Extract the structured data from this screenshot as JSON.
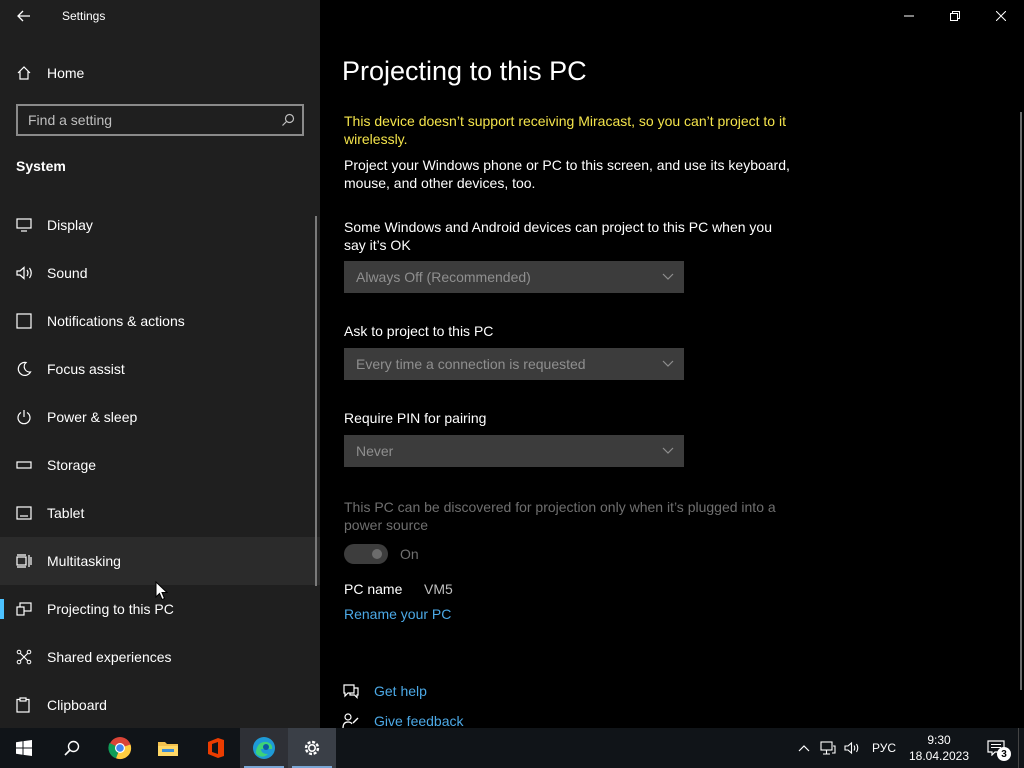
{
  "window": {
    "title": "Settings"
  },
  "sidebar": {
    "home_label": "Home",
    "search_placeholder": "Find a setting",
    "section_title": "System",
    "items": [
      {
        "label": "Display",
        "icon": "display-icon"
      },
      {
        "label": "Sound",
        "icon": "speaker-icon"
      },
      {
        "label": "Notifications & actions",
        "icon": "notifications-icon"
      },
      {
        "label": "Focus assist",
        "icon": "moon-icon"
      },
      {
        "label": "Power & sleep",
        "icon": "power-icon"
      },
      {
        "label": "Storage",
        "icon": "storage-icon"
      },
      {
        "label": "Tablet",
        "icon": "tablet-icon"
      },
      {
        "label": "Multitasking",
        "icon": "multitasking-icon"
      },
      {
        "label": "Projecting to this PC",
        "icon": "projecting-icon"
      },
      {
        "label": "Shared experiences",
        "icon": "shared-experiences-icon"
      },
      {
        "label": "Clipboard",
        "icon": "clipboard-icon"
      }
    ],
    "selected_index": 8,
    "hover_index": 7
  },
  "main": {
    "title": "Projecting to this PC",
    "warning": "This device doesn’t support receiving Miracast, so you can’t project to it wirelessly.",
    "intro": "Project your Windows phone or PC to this screen, and use its keyboard, mouse, and other devices, too.",
    "availability_label": "Some Windows and Android devices can project to this PC when you say it’s OK",
    "availability_value": "Always Off (Recommended)",
    "ask_label": "Ask to project to this PC",
    "ask_value": "Every time a connection is requested",
    "pin_label": "Require PIN for pairing",
    "pin_value": "Never",
    "power_text": "This PC can be discovered for projection only when it’s plugged into a power source",
    "power_toggle_label": "On",
    "pc_name_label": "PC name",
    "pc_name_value": "VM5",
    "rename_link": "Rename your PC",
    "get_help": "Get help",
    "give_feedback": "Give feedback"
  },
  "taskbar": {
    "apps": [
      "start-icon",
      "search-icon",
      "chrome-icon",
      "file-explorer-icon",
      "office-icon",
      "edge-icon",
      "settings-icon"
    ],
    "language": "РУС",
    "time": "9:30",
    "date": "18.04.2023",
    "notification_count": "3"
  },
  "colors": {
    "accent": "#4cc2ff",
    "warning": "#f4e44b",
    "link": "#4ca9e6"
  }
}
